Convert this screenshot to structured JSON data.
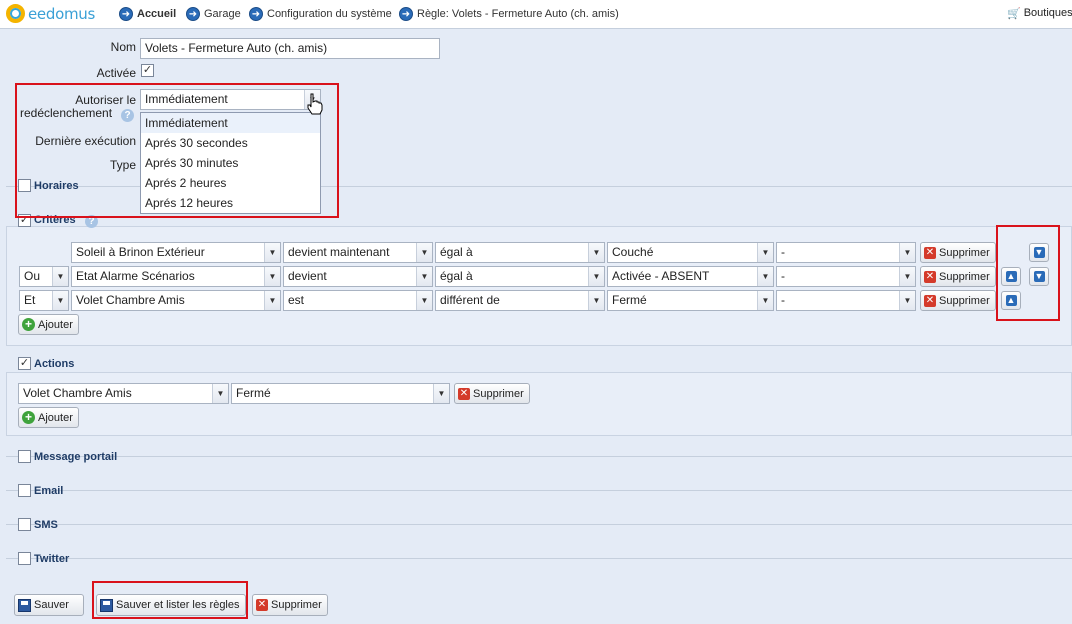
{
  "brand": {
    "name": "eedomus"
  },
  "breadcrumb": [
    "Accueil",
    "Garage",
    "Configuration du système",
    "Règle: Volets - Fermeture Auto (ch. amis)"
  ],
  "shop": "Boutiques",
  "form": {
    "nom_label": "Nom",
    "nom_value": "Volets - Fermeture Auto (ch. amis)",
    "activee_label": "Activée",
    "autoriser_label_1": "Autoriser le",
    "autoriser_label_2": "redéclenchement",
    "autoriser_value": "Immédiatement",
    "derniere_label": "Dernière exécution",
    "type_label": "Type",
    "options": [
      "Immédiatement",
      "Aprés 30 secondes",
      "Aprés 30 minutes",
      "Aprés 2 heures",
      "Aprés 12 heures"
    ]
  },
  "sections": {
    "horaires": "Horaires",
    "criteres": "Critères",
    "actions": "Actions",
    "message_portail": "Message portail",
    "email": "Email",
    "sms": "SMS",
    "twitter": "Twitter"
  },
  "criteria": [
    {
      "op": "",
      "device": "Soleil à Brinon Extérieur",
      "verb": "devient maintenant",
      "cmp": "égal à",
      "value": "Couché",
      "extra": "-"
    },
    {
      "op": "Ou",
      "device": "Etat Alarme Scénarios",
      "verb": "devient",
      "cmp": "égal à",
      "value": "Activée - ABSENT",
      "extra": "-"
    },
    {
      "op": "Et",
      "device": "Volet Chambre Amis",
      "verb": "est",
      "cmp": "différent de",
      "value": "Fermé",
      "extra": "-"
    }
  ],
  "action_row": {
    "device": "Volet Chambre Amis",
    "value": "Fermé"
  },
  "buttons": {
    "supprimer": "Supprimer",
    "ajouter": "Ajouter",
    "sauver": "Sauver",
    "sauver_lister": "Sauver et lister les règles"
  },
  "icons": {
    "arrow_up": "▲",
    "arrow_down": "▼",
    "check": "✓",
    "help": "?"
  }
}
